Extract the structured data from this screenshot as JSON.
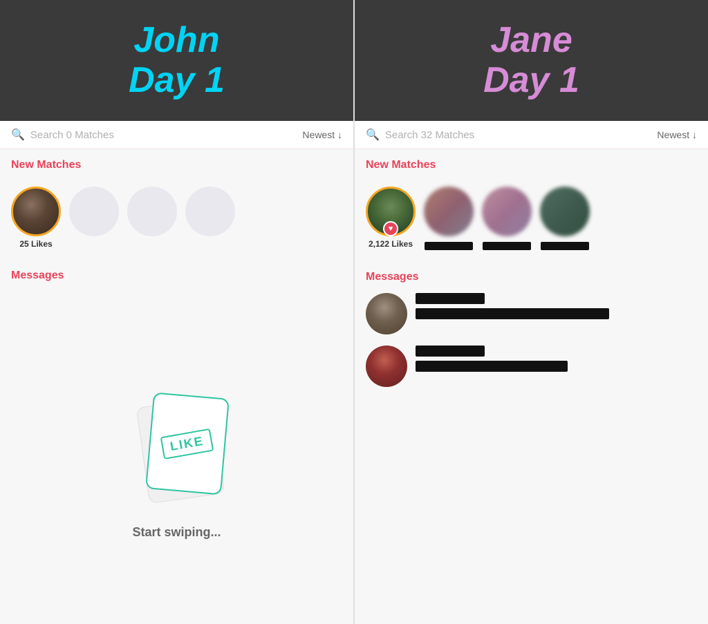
{
  "left": {
    "header": {
      "line1": "John",
      "line2": "Day 1",
      "color_class": "john"
    },
    "search": {
      "placeholder": "Search 0 Matches",
      "sort": "Newest ↓"
    },
    "new_matches": {
      "title": "New Matches",
      "matches": [
        {
          "type": "likes",
          "label": "25 Likes",
          "has_ring": true
        },
        {
          "type": "placeholder"
        },
        {
          "type": "placeholder"
        },
        {
          "type": "placeholder"
        }
      ]
    },
    "messages": {
      "title": "Messages",
      "empty": true,
      "start_text": "Start swiping..."
    }
  },
  "right": {
    "header": {
      "line1": "Jane",
      "line2": "Day 1",
      "color_class": "jane"
    },
    "search": {
      "placeholder": "Search 32 Matches",
      "sort": "Newest ↓"
    },
    "new_matches": {
      "title": "New Matches",
      "matches": [
        {
          "type": "likes",
          "label": "2,122 Likes",
          "has_ring": true,
          "has_heart": true
        },
        {
          "type": "blurred",
          "label": ""
        },
        {
          "type": "blurred",
          "label": ""
        },
        {
          "type": "blurred",
          "label": ""
        }
      ]
    },
    "messages": {
      "title": "Messages",
      "items": [
        {
          "name_bar": "short",
          "msg_bar": "long",
          "avatar_class": "person1"
        },
        {
          "name_bar": "short",
          "msg_bar": "medium",
          "avatar_class": "person2"
        }
      ]
    }
  },
  "icons": {
    "search": "🔍",
    "heart": "♥"
  }
}
